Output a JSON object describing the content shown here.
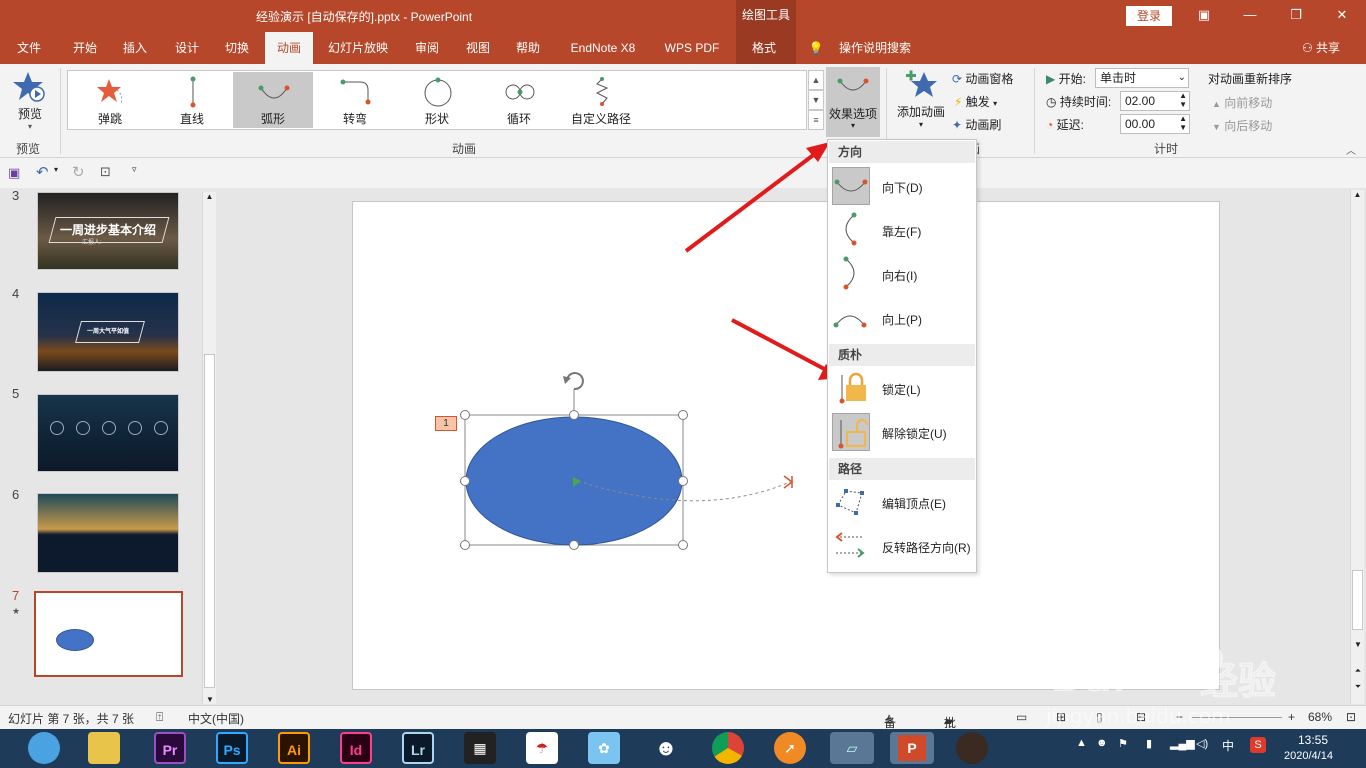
{
  "titlebar": {
    "doc_title": "经验演示 [自动保存的].pptx  -  PowerPoint",
    "context_tab_header": "绘图工具",
    "login": "登录"
  },
  "tabs": [
    {
      "label": "文件"
    },
    {
      "label": "开始"
    },
    {
      "label": "插入"
    },
    {
      "label": "设计"
    },
    {
      "label": "切换"
    },
    {
      "label": "动画"
    },
    {
      "label": "幻灯片放映"
    },
    {
      "label": "审阅"
    },
    {
      "label": "视图"
    },
    {
      "label": "帮助"
    },
    {
      "label": "EndNote X8"
    },
    {
      "label": "WPS PDF"
    },
    {
      "label": "格式"
    }
  ],
  "tell_me": "操作说明搜索",
  "share": "共享",
  "ribbon": {
    "preview_label": "预览",
    "preview_group": "预览",
    "gallery_items": [
      {
        "label": "弹跳"
      },
      {
        "label": "直线"
      },
      {
        "label": "弧形"
      },
      {
        "label": "转弯"
      },
      {
        "label": "形状"
      },
      {
        "label": "循环"
      },
      {
        "label": "自定义路径"
      }
    ],
    "animation_group": "动画",
    "effect_options": "效果选项",
    "add_animation": "添加动画",
    "animation_pane": "动画窗格",
    "trigger": "触发",
    "animation_painter": "动画刷",
    "timing_group": "计时",
    "start_label": "开始:",
    "start_value": "单击时",
    "duration_label": "持续时间:",
    "duration_value": "02.00",
    "delay_label": "延迟:",
    "delay_value": "00.00",
    "reorder_label": "对动画重新排序",
    "move_earlier": "向前移动",
    "move_later": "向后移动"
  },
  "slides": {
    "numbers": [
      "3",
      "4",
      "5",
      "6",
      "7"
    ],
    "slide3_title": "一周进步基本介绍",
    "slide3_sub": "汇报人:",
    "slide4_title": "一周大气平如值",
    "current_star": "★"
  },
  "canvas": {
    "anim_tag": "1"
  },
  "menu": {
    "direction_header": "方向",
    "direction_items": [
      {
        "label": "向下(D)"
      },
      {
        "label": "靠左(F)"
      },
      {
        "label": "向右(I)"
      },
      {
        "label": "向上(P)"
      }
    ],
    "simplicity_header": "质朴",
    "lock_items": [
      {
        "label": "锁定(L)"
      },
      {
        "label": "解除锁定(U)"
      }
    ],
    "path_header": "路径",
    "path_items": [
      {
        "label": "编辑顶点(E)"
      },
      {
        "label": "反转路径方向(R)"
      }
    ]
  },
  "statusbar": {
    "slide_info": "幻灯片 第 7 张，共 7 张",
    "language": "中文(中国)",
    "notes": "备注",
    "comments": "批注",
    "zoom": "68%"
  },
  "taskbar": {
    "apps": [
      "Pr",
      "Ps",
      "Ai",
      "Id",
      "Lr"
    ],
    "time": "13:55",
    "date": "2020/4/14",
    "ime": "中"
  },
  "watermark": {
    "text": "jingyan.baidu.com"
  },
  "colors": {
    "accent": "#b7472a",
    "shape_fill": "#4472c4",
    "arrow": "#e11b1b"
  }
}
